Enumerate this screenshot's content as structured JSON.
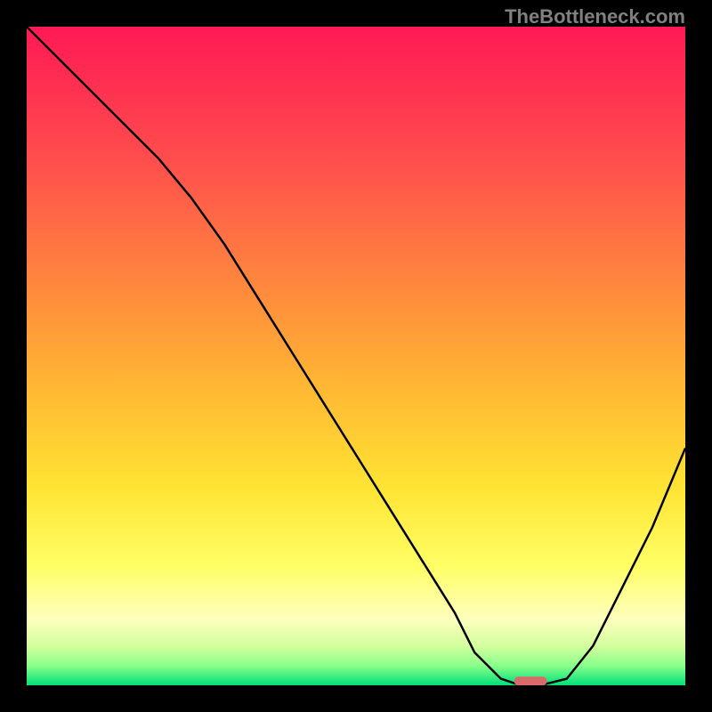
{
  "watermark": "TheBottleneck.com",
  "chart_data": {
    "type": "line",
    "title": "",
    "xlabel": "",
    "ylabel": "",
    "xlim": [
      0,
      100
    ],
    "ylim": [
      0,
      100
    ],
    "series": [
      {
        "name": "bottleneck-curve",
        "x": [
          0,
          5,
          10,
          15,
          20,
          25,
          30,
          35,
          40,
          45,
          50,
          55,
          60,
          65,
          68,
          72,
          75,
          78,
          82,
          86,
          90,
          95,
          100
        ],
        "y": [
          100,
          95,
          90,
          85,
          80,
          74,
          67,
          59,
          51,
          43,
          35,
          27,
          19,
          11,
          5,
          1,
          0,
          0,
          1,
          6,
          14,
          24,
          36
        ]
      }
    ],
    "marker": {
      "x_start": 74,
      "x_end": 79,
      "y": 0.5,
      "color": "#d96a6a"
    },
    "gradient_stops": [
      {
        "offset": 0,
        "color": "#ff1955"
      },
      {
        "offset": 20,
        "color": "#ff4d4d"
      },
      {
        "offset": 40,
        "color": "#ff8a3d"
      },
      {
        "offset": 55,
        "color": "#ffb833"
      },
      {
        "offset": 70,
        "color": "#ffe433"
      },
      {
        "offset": 82,
        "color": "#ffff66"
      },
      {
        "offset": 90,
        "color": "#fdffbd"
      },
      {
        "offset": 94,
        "color": "#d4ff9e"
      },
      {
        "offset": 97,
        "color": "#8aff8a"
      },
      {
        "offset": 100,
        "color": "#00e07a"
      }
    ]
  }
}
